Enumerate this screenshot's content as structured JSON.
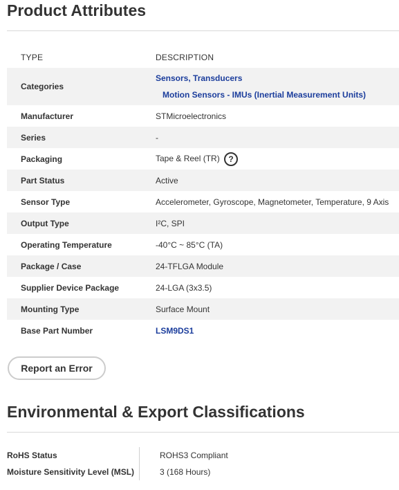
{
  "product_attributes": {
    "title": "Product Attributes",
    "header_type": "TYPE",
    "header_description": "DESCRIPTION",
    "categories": {
      "label": "Categories",
      "links": [
        "Sensors, Transducers",
        "Motion Sensors - IMUs (Inertial Measurement Units)"
      ]
    },
    "rows": [
      {
        "label": "Manufacturer",
        "value": "STMicroelectronics"
      },
      {
        "label": "Series",
        "value": "-"
      },
      {
        "label": "Packaging",
        "value": "Tape & Reel (TR)",
        "help_icon": "question-circle-icon",
        "help_glyph": "?"
      },
      {
        "label": "Part Status",
        "value": "Active"
      },
      {
        "label": "Sensor Type",
        "value": "Accelerometer, Gyroscope, Magnetometer, Temperature, 9 Axis"
      },
      {
        "label": "Output Type",
        "value": "I²C, SPI"
      },
      {
        "label": "Operating Temperature",
        "value": "-40°C ~ 85°C (TA)"
      },
      {
        "label": "Package / Case",
        "value": "24-TFLGA Module"
      },
      {
        "label": "Supplier Device Package",
        "value": "24-LGA (3x3.5)"
      },
      {
        "label": "Mounting Type",
        "value": "Surface Mount"
      },
      {
        "label": "Base Part Number",
        "value": "LSM9DS1",
        "is_link": true
      }
    ]
  },
  "report_button": {
    "label": "Report an Error"
  },
  "environmental": {
    "title": "Environmental & Export Classifications",
    "rows": [
      {
        "label": "RoHS Status",
        "value": "ROHS3 Compliant"
      },
      {
        "label": "Moisture Sensitivity Level (MSL)",
        "value": "3 (168 Hours)"
      }
    ]
  },
  "colors": {
    "link": "#1b3d9c",
    "row_shade": "#f2f2f2",
    "text": "#333333",
    "divider": "#d8d8d8"
  }
}
